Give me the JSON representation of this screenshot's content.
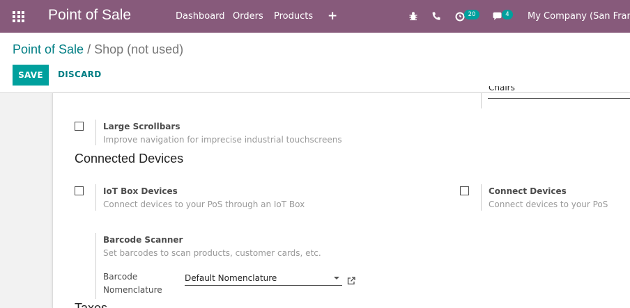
{
  "navbar": {
    "brand": "Point of Sale",
    "menu": [
      "Dashboard",
      "Orders",
      "Products"
    ],
    "plus_label": "+",
    "activity_count": "20",
    "messages_count": "4",
    "company": "My Company (San Francis"
  },
  "breadcrumb": {
    "parent": "Point of Sale",
    "separator": "/",
    "current": "Shop (not used)"
  },
  "buttons": {
    "save": "SAVE",
    "discard": "DISCARD"
  },
  "form": {
    "partial_field_text": "Chairs",
    "large_scrollbars": {
      "title": "Large Scrollbars",
      "desc": "Improve navigation for imprecise industrial touchscreens",
      "checked": false
    },
    "connected_devices_heading": "Connected Devices",
    "iot_box": {
      "title": "IoT Box Devices",
      "desc": "Connect devices to your PoS through an IoT Box",
      "checked": false
    },
    "connect_devices": {
      "title": "Connect Devices",
      "desc": "Connect devices to your PoS",
      "checked": false
    },
    "barcode_scanner": {
      "title": "Barcode Scanner",
      "desc": "Set barcodes to scan products, customer cards, etc.",
      "nomenclature_label_1": "Barcode",
      "nomenclature_label_2": "Nomenclature",
      "nomenclature_value": "Default Nomenclature"
    },
    "next_heading": "Taxes"
  },
  "colors": {
    "navbar": "#875a7b",
    "primary": "#00a09d",
    "link": "#017e84"
  }
}
